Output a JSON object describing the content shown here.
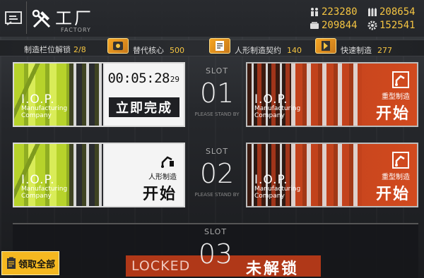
{
  "header": {
    "title_cn": "工厂",
    "title_en": "FACTORY",
    "resources": {
      "manpower": "223280",
      "ammo": "208654",
      "ration": "209844",
      "parts": "152541"
    }
  },
  "info_bar": {
    "slots_label": "制造栏位解锁",
    "slots_value": "2/8",
    "core_label": "替代核心",
    "core_value": "500",
    "contract_label": "人形制造契约",
    "contract_value": "140",
    "quick_label": "快速制造",
    "quick_value": "277"
  },
  "slots": [
    {
      "slot_label": "SLOT",
      "number": "01",
      "standby": "PLEASE STAND BY",
      "left": {
        "brand": "I.O.P.",
        "brand_sub1": "Manufacturing",
        "brand_sub2": "Company",
        "timer": "00:05:28",
        "timer_sec": "29",
        "finish_label": "立即完成"
      },
      "right": {
        "brand": "I.O.P.",
        "brand_sub1": "Manufacturing",
        "brand_sub2": "Company",
        "kind": "重型制造",
        "start_label": "开始"
      }
    },
    {
      "slot_label": "SLOT",
      "number": "02",
      "standby": "PLEASE STAND BY",
      "left": {
        "brand": "I.O.P.",
        "brand_sub1": "Manufacturing",
        "brand_sub2": "Company",
        "kind": "人形制造",
        "start_label": "开始"
      },
      "right": {
        "brand": "I.O.P.",
        "brand_sub1": "Manufacturing",
        "brand_sub2": "Company",
        "kind": "重型制造",
        "start_label": "开始"
      }
    },
    {
      "slot_label": "SLOT",
      "number": "03",
      "locked_en": "LOCKED",
      "locked_cn": "未解锁"
    }
  ],
  "claim_all_label": "领取全部",
  "colors": {
    "accent_yellow": "#f5c542",
    "slot_green": "#b7d32b",
    "slot_orange": "#c2421c"
  }
}
